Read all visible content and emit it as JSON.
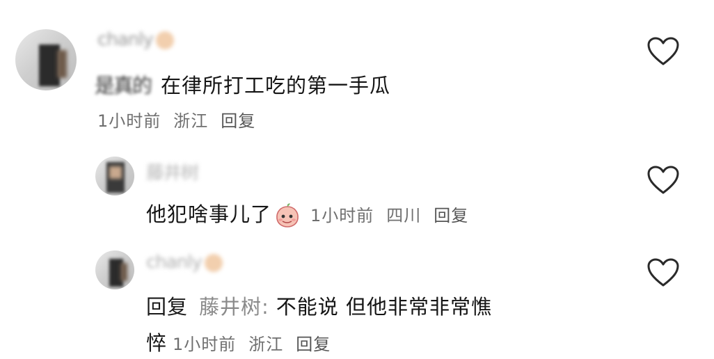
{
  "comments": [
    {
      "name_obscured": "chanly",
      "text_prefix_obscured": "是真的",
      "text": "在律所打工吃的第一手瓜",
      "time": "1小时前",
      "location": "浙江",
      "reply_label": "回复",
      "like_icon": "heart-outline-icon"
    },
    {
      "name_obscured": "藤井树",
      "text": "他犯啥事儿了",
      "emoji": "peach-face-emoji",
      "time": "1小时前",
      "location": "四川",
      "reply_label": "回复",
      "like_icon": "heart-outline-icon"
    },
    {
      "name_obscured": "chanly",
      "reply_prefix": "回复",
      "reply_target": "藤井树:",
      "text_line1": "不能说 但他非常非常憔",
      "text_line2": "悴",
      "time": "1小时前",
      "location": "浙江",
      "reply_label": "回复",
      "like_icon": "heart-outline-icon"
    }
  ],
  "colors": {
    "text": "#151515",
    "meta": "#6f6f6f",
    "heart_stroke": "#2a2a2a"
  }
}
